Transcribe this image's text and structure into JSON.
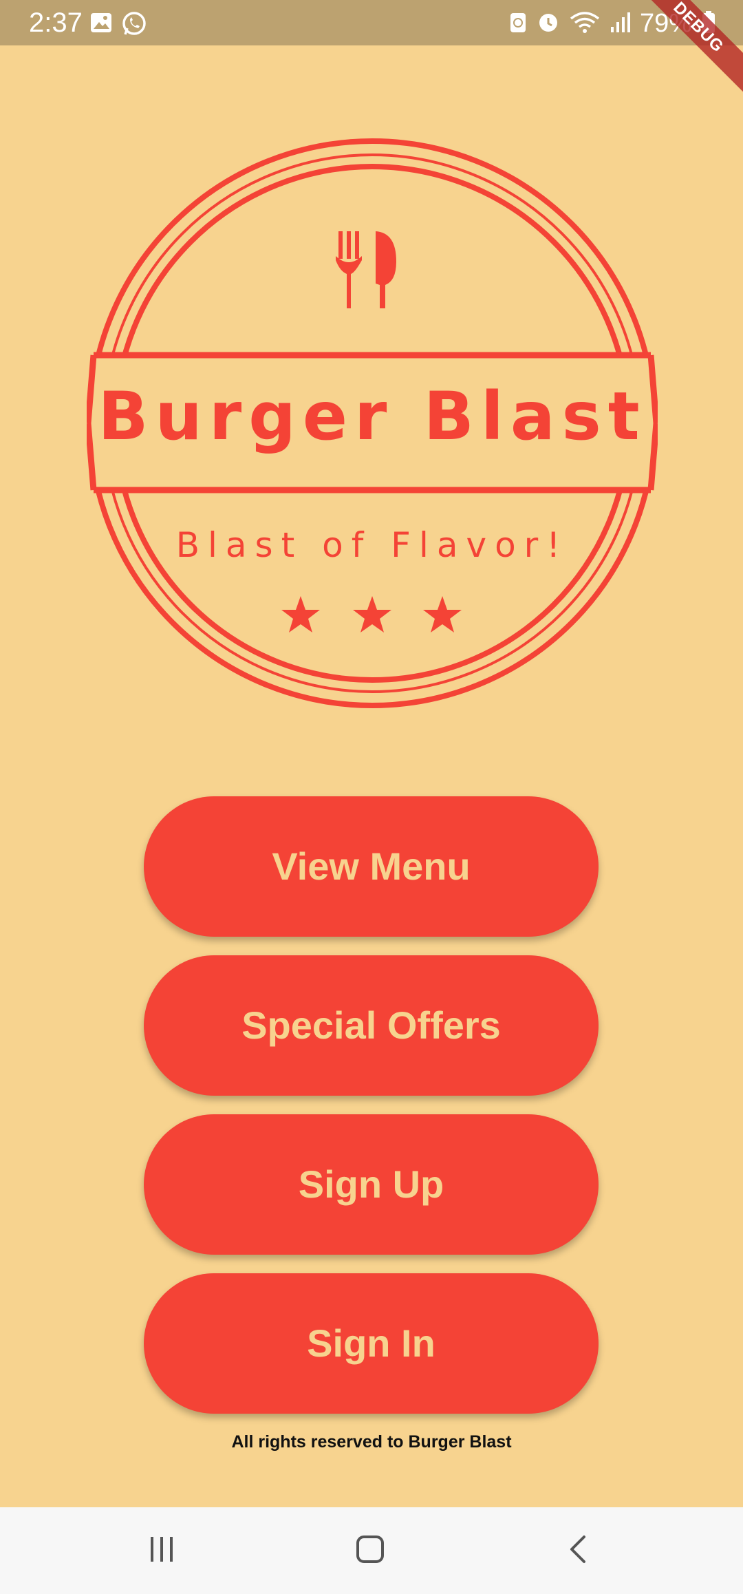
{
  "status_bar": {
    "time": "2:37",
    "battery": "79%",
    "left_icons": [
      "gallery-icon",
      "whatsapp-icon"
    ],
    "right_icons": [
      "sync-icon",
      "alarm-icon",
      "wifi-icon",
      "signal-icon",
      "battery-icon"
    ]
  },
  "debug_banner": "DEBUG",
  "logo": {
    "title": "Burger Blast",
    "tagline": "Blast of Flavor!",
    "icon": "fork-spoon-icon",
    "stars": 3,
    "color": "#f44336"
  },
  "buttons": {
    "view_menu": "View Menu",
    "special_offers": "Special Offers",
    "sign_up": "Sign Up",
    "sign_in": "Sign In"
  },
  "footer": "All rights reserved to Burger Blast",
  "nav_bar": {
    "recent": "recent-apps-icon",
    "home": "home-icon",
    "back": "back-icon"
  },
  "colors": {
    "background": "#f7d38f",
    "status_bar": "#bca270",
    "accent": "#f44336",
    "button_text": "#f7d38f"
  }
}
